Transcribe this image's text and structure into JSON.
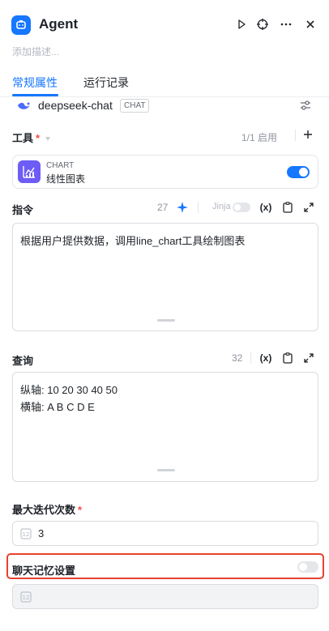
{
  "header": {
    "title": "Agent",
    "description_placeholder": "添加描述..."
  },
  "tabs": [
    {
      "label": "常规属性",
      "active": true
    },
    {
      "label": "运行记录",
      "active": false
    }
  ],
  "model": {
    "name": "deepseek-chat",
    "tag": "CHAT"
  },
  "tools": {
    "label": "工具",
    "required_mark": "*",
    "count_text": "1/1 启用",
    "items": [
      {
        "type": "CHART",
        "name": "线性图表",
        "enabled": true
      }
    ]
  },
  "instruction": {
    "label": "指令",
    "count": "27",
    "jinja_label": "Jinja",
    "variable_icon": "(x)",
    "content": "根据用户提供数据，调用line_chart工具绘制图表"
  },
  "query": {
    "label": "查询",
    "count": "32",
    "variable_icon": "(x)",
    "lines": [
      "纵轴: 10 20 30 40 50",
      "横轴: A B C D E"
    ]
  },
  "max_iterations": {
    "label": "最大迭代次数",
    "required_mark": "*",
    "value": "3"
  },
  "memory": {
    "label": "聊天记忆设置",
    "enabled": false
  },
  "colors": {
    "accent": "#1677ff",
    "tool_icon": "#6d5cf5",
    "highlight": "#e8412d"
  }
}
